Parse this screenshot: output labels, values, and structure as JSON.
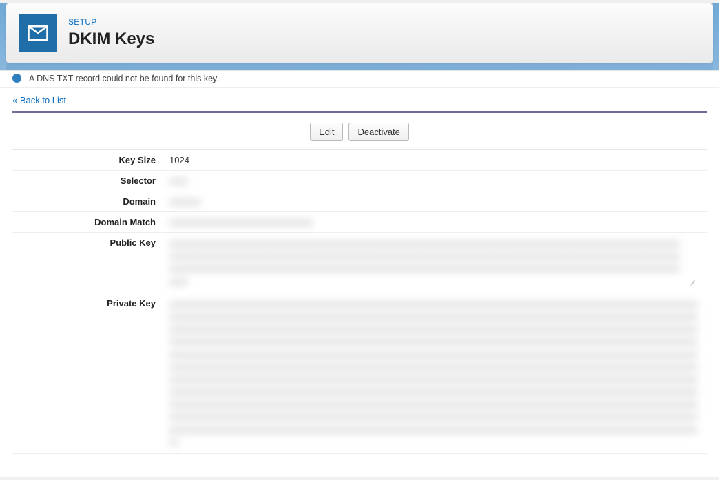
{
  "header": {
    "section": "SETUP",
    "title": "DKIM Keys"
  },
  "alert": {
    "text": "A DNS TXT record could not be found for this key."
  },
  "nav": {
    "back_label": "« Back to List"
  },
  "toolbar": {
    "edit_label": "Edit",
    "deactivate_label": "Deactivate"
  },
  "fields": {
    "key_size": {
      "label": "Key Size",
      "value": "1024"
    },
    "selector": {
      "label": "Selector",
      "value_masked": "xxxx"
    },
    "domain": {
      "label": "Domain",
      "value_masked": "xxxxxxx"
    },
    "domain_match": {
      "label": "Domain Match",
      "value_masked": "xxxxxxxxxxxxxxxxxxxxxxxxxxxxxxxx"
    },
    "public_key": {
      "label": "Public Key",
      "value_masked": "xxxxxxxxxxxxxxxxxxxxxxxxxxxxxxxxxxxxxxxxxxxxxxxxxxxxxxxxxxxxxxxxxxxxxxxxxxxxxxxxxxxxxxxxxxxxxxxxxxxxxxxxxxxxxxxxxxxxxxxxxxxxxxxxxxxxxxxxxxxxxxxxxxxxxxxxxxxxxxxxxxxxxxxxxxxxxxxxxxxxxxxxxxxxxxxxxxxxxxxxxxxxxxxxxxxxxxxxxxxxxxxxxxxxxxxxxxxxxxxxxxxxxxxxxxxxxxxxxxxxxxxxxxxxxxxxxxxxxxxxxxxxxxxxxxxxxxxxxxxxxxxxxxxxxxxxxxxxxxxxxxxxxxxxxxxxxxxxxxxxxxxxxx"
    },
    "private_key": {
      "label": "Private Key",
      "value_masked": "xxxxxxxxxxxxxxxxxxxxxxxxxxxxxxxxxxxxxxxxxxxxxxxxxxxxxxxxxxxxxxxxxxxxxxxxxxxxxxxxxxxxxxxxxxxxxxxxxxxxxxxxxxxxxxxxxxxxxxxxxxxxxxxxxxxxxxxxxxxxxxxxxxxxxxxxxxxxxxxxxxxxxxxxxxxxxxxxxxxxxxxxxxxxxxxxxxxxxxxxxxxxxxxxxxxxxxxxxxxxxxxxxxxxxxxxxxxxxxxxxxxxxxxxxxxxxxxxxxxxxxxxxxxxxxxxxxxxxxxxxxxxxxxxxxxxxxxxxxxxxxxxxxxxxxxxxxxxxxxxxxxxxxxxxxxxxxxxxxxxxxxxxxxxxxxxxxxxxxxxxxxxxxxxxxxxxxxxxxxxxxxxxxxxxxxxxxxxxxxxxxxxxxxxxxxxxxxxxxxxxxxxxxxxxxxxxxxxxxxxxxxxxxxxxxxxxxxxxxxxxxxxxxxxxxxxxxxxxxxxxxxxxxxxxxxxxxxxxxxxxxxxxxxxxxxxxxxxxxxxxxxxxxxxxxxxxxxxxxxxxxxxxxxxxxxxxxxxxxxxxxxxxxxxxxxxxxxxxxxxxxxxxxxxxxxxxxxxxxxxxxxxxxxxxxxxxxxxxxxxxxxxxxxxxxxxxxxxxxxxxxxxxxxxxxxxxxxxxxxxxxxxxxxxxxxxxxxxxxxxxxxxxxxxxxxxxxxxxxxxxxxxxxxxxxxxxxxxxxxxxxxxxxxxxxxxxxxxxxxxxxxxxxxxxxxxxxxxxxxxxxxxxxxxxxxxxxxxxxxxxxxxxxxxxxxxxxxxxxxxxxxxxxxxxxxxxxxxxxxxxxxxxxxxxxxxxxxxxxxxxxxxxxxxxxxxxxxxxxxxxxxxxxxxxxxxxxxxxxxxxxxxxxxxxxxxxxxxxxxxxxxxxxxxxxxxxxxxxxxxxxxxxxxxxxxxxxxxxxxxxxxxxxxxxxxxxxxxxxxxxxxxxxxxxxxxxxxxxxxxxxxxxxxxxxxxxxxxxxxxxxxxxxxxxxxxxxxxxxxxxxxxxxxxxxxxxxxxxxxxxxxxxxxxxxxxxxxxxxxxxxxxxxxxxxxxxxxxxxxxxxxxxxxxxxxxxxxxxxxxxxxxxxxxxxxxxxxxxxxxxxxxxxxxxxxxxxxxxxxxxxxxxxxxxxxxxxxxxxxxxxxxxxxxxxxxxxxxxxxxxxxxxxxxxxxxxxxxxxxxxxxxxxxxxxxxxxxxxxxxxxxxxxxxxxxxxxxxxxxxxxxxxxxxxxxxxxxxxxxxxxxxxxxxxxxxxxxxxxxxxxxxxxxxxxxxxxxxxxxx"
    }
  }
}
